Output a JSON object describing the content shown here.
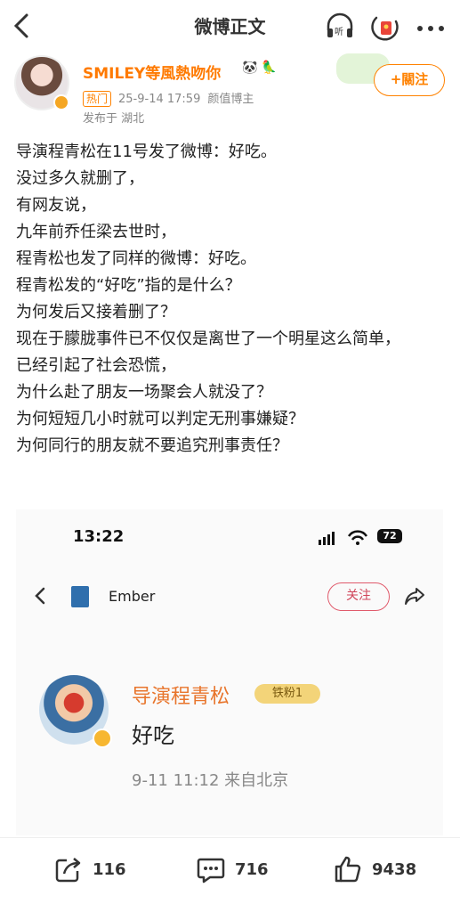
{
  "nav": {
    "title": "微博正文"
  },
  "author": {
    "name": "SMILEY等風熱吻你",
    "follow_label": "+關注",
    "hot_tag": "热门",
    "datetime": "25-9-14 17:59",
    "role": "颜值博主",
    "location": "发布于 湖北"
  },
  "post": {
    "lines": [
      "导演程青松在11号发了微博：好吃。",
      "没过多久就删了，",
      "有网友说，",
      "九年前乔任梁去世时，",
      "程青松也发了同样的微博：好吃。",
      "程青松发的“好吃”指的是什么？",
      "为何发后又接着删了？",
      "现在于朦胧事件已不仅仅是离世了一个明星这么简单，",
      "已经引起了社会恐慌，",
      "为什么赴了朋友一场聚会人就没了？",
      "为何短短几小时就可以判定无刑事嫌疑？",
      "为何同行的朋友就不要追究刑事责任？"
    ]
  },
  "screenshot": {
    "time": "13:22",
    "battery": "72",
    "header_name": "Ember",
    "follow_label": "关注",
    "user_name": "导演程青松",
    "fan_badge": "铁粉1",
    "text": "好吃",
    "meta": "9-11 11:12  来自北京"
  },
  "actions": {
    "repost_count": "116",
    "comment_count": "716",
    "like_count": "9438"
  }
}
